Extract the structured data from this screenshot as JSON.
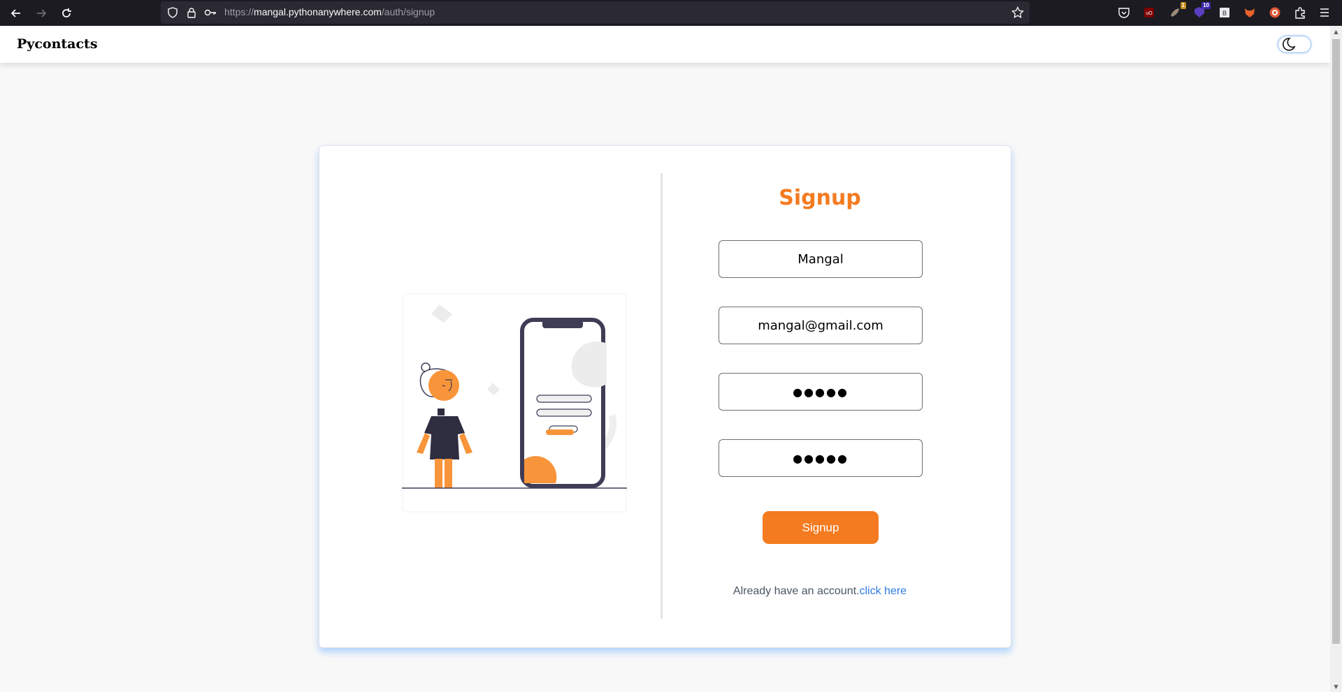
{
  "browser": {
    "url_prefix": "https://",
    "url_host": "mangal.pythonanywhere.com",
    "url_path": "/auth/signup",
    "extensions": [
      {
        "name": "ublock-icon",
        "badge": ""
      },
      {
        "name": "extension-1-icon",
        "badge": "1"
      },
      {
        "name": "extension-10-icon",
        "badge": "10"
      },
      {
        "name": "bitwarden-icon",
        "badge": ""
      },
      {
        "name": "fox-extension-icon",
        "badge": ""
      },
      {
        "name": "duckduckgo-icon",
        "badge": ""
      }
    ]
  },
  "nav": {
    "brand": "Pycontacts",
    "theme_toggle_icon": "moon-icon"
  },
  "form": {
    "title": "Signup",
    "name_value": "Mangal",
    "email_value": "mangal@gmail.com",
    "password_value": "●●●●●",
    "confirm_value": "●●●●●",
    "submit_label": "Signup",
    "login_prompt": "Already have an account.",
    "login_link": "click here"
  },
  "colors": {
    "accent": "#f47b20",
    "link": "#2f7be2",
    "card_glow": "#78b4ff"
  }
}
